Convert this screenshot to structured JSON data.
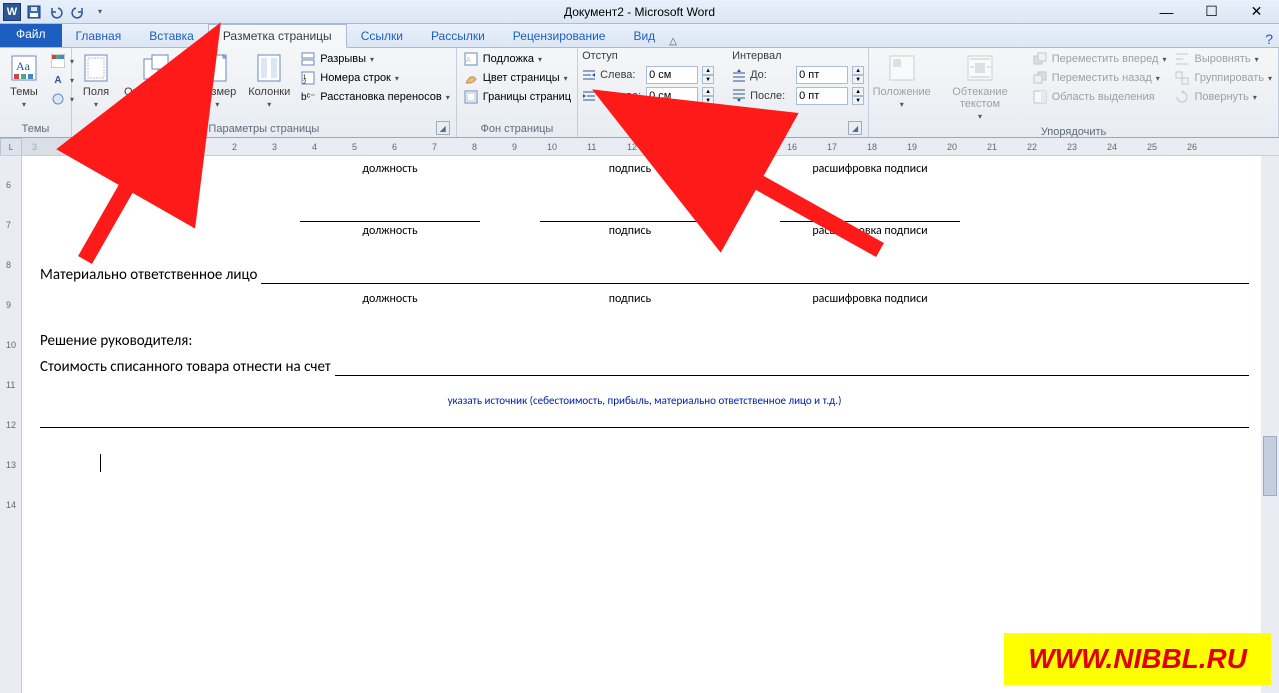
{
  "title": "Документ2 - Microsoft Word",
  "qat": {
    "word": "W"
  },
  "tabs": {
    "file": "Файл",
    "items": [
      "Главная",
      "Вставка",
      "Разметка страницы",
      "Ссылки",
      "Рассылки",
      "Рецензирование",
      "Вид"
    ],
    "active_index": 2
  },
  "ribbon": {
    "themes": {
      "label": "Темы",
      "btn": "Темы"
    },
    "page_setup": {
      "label": "Параметры страницы",
      "margins": "Поля",
      "orientation": "Ориентация",
      "size": "Размер",
      "columns": "Колонки",
      "breaks": "Разрывы",
      "line_numbers": "Номера строк",
      "hyphenation": "Расстановка переносов"
    },
    "page_bg": {
      "label": "Фон страницы",
      "watermark": "Подложка",
      "color": "Цвет страницы",
      "borders": "Границы страниц"
    },
    "paragraph": {
      "label": "Абзац",
      "indent_head": "Отступ",
      "spacing_head": "Интервал",
      "left_lbl": "Слева:",
      "right_lbl": "Справа:",
      "before_lbl": "До:",
      "after_lbl": "После:",
      "left_val": "0 см",
      "right_val": "0 см",
      "before_val": "0 пт",
      "after_val": "0 пт"
    },
    "arrange": {
      "label": "Упорядочить",
      "position": "Положение",
      "wrap": "Обтекание текстом",
      "bring_fwd": "Переместить вперед",
      "send_back": "Переместить назад",
      "selection_pane": "Область выделения",
      "align": "Выровнять",
      "group": "Группировать",
      "rotate": "Повернуть"
    }
  },
  "ruler_corner": "L",
  "vruler_marks": [
    "6",
    "7",
    "8",
    "9",
    "10",
    "11",
    "12",
    "13",
    "14"
  ],
  "doc": {
    "sig_labels": {
      "position": "должность",
      "signature": "подпись",
      "decipher": "расшифровка подписи"
    },
    "responsible": "Материально ответственное лицо",
    "decision": "Решение руководителя:",
    "cost_line": "Стоимость списанного товара отнести на счет",
    "note": "указать источник (себестоимость, прибыль, материально ответственное лицо и т.д.)"
  },
  "watermark": "WWW.NIBBL.RU"
}
